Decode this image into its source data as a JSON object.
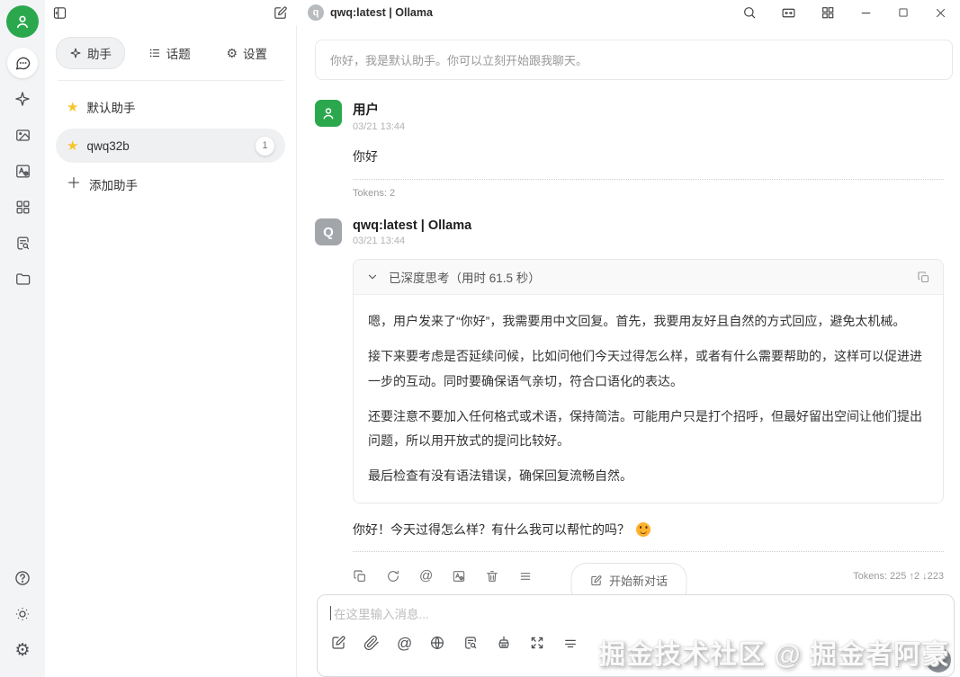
{
  "titlebar": {
    "model": {
      "avatar_letter": "q",
      "label": "qwq:latest | Ollama"
    },
    "icons": [
      "collapse-sidebar",
      "compose",
      "search",
      "expand-window",
      "apps-grid",
      "minimize",
      "maximize",
      "close"
    ]
  },
  "rail": {
    "icons": [
      "user-avatar",
      "chat",
      "assistants-sparkle",
      "images",
      "translate",
      "mini-apps",
      "knowledge-search",
      "files-folder"
    ],
    "bottom_icons": [
      "help",
      "theme-light",
      "settings"
    ]
  },
  "assistants_panel": {
    "tabs": [
      {
        "label": "助手",
        "icon": "sparkle-icon",
        "selected": true
      },
      {
        "label": "话题",
        "icon": "list-icon",
        "selected": false
      },
      {
        "label": "设置",
        "icon": "gear-icon",
        "selected": false
      }
    ],
    "assistants": [
      {
        "label": "默认助手",
        "icon": "star-icon",
        "selected": false
      },
      {
        "label": "qwq32b",
        "icon": "star-icon",
        "badge": "1",
        "selected": true
      }
    ],
    "add_assistant_label": "添加助手"
  },
  "chat": {
    "greeting": "你好，我是默认助手。你可以立刻开始跟我聊天。",
    "messages": [
      {
        "role": "user",
        "name": "用户",
        "time": "03/21 13:44",
        "content": "你好",
        "tokens": "Tokens: 2"
      },
      {
        "role": "assistant",
        "name": "qwq:latest | Ollama",
        "time": "03/21 13:44",
        "avatar_letter": "Q",
        "thinking_header": "已深度思考（用时 61.5 秒）",
        "thinking_paragraphs": [
          "嗯，用户发来了“你好”，我需要用中文回复。首先，我要用友好且自然的方式回应，避免太机械。",
          "接下来要考虑是否延续问候，比如问他们今天过得怎么样，或者有什么需要帮助的，这样可以促进进一步的互动。同时要确保语气亲切，符合口语化的表达。",
          "还要注意不要加入任何格式或术语，保持简洁。可能用户只是打个招呼，但最好留出空间让他们提出问题，所以用开放式的提问比较好。",
          "最后检查有没有语法错误，确保回复流畅自然。"
        ],
        "response": "你好！今天过得怎么样？有什么我可以帮忙的吗？",
        "response_emoji": "😊",
        "tokens": "Tokens: 225 ↑2 ↓223",
        "toolbar_icons": [
          "copy",
          "regenerate",
          "mention",
          "translate",
          "delete",
          "menu"
        ]
      }
    ],
    "new_topic_button": "开始新对话"
  },
  "input": {
    "placeholder": "在这里输入消息...",
    "icons": [
      "new-topic",
      "attach",
      "mention",
      "web-search",
      "knowledge",
      "clear-context",
      "fullscreen",
      "collapse-input"
    ]
  },
  "watermark": "掘金技术社区 @ 掘金者阿豪",
  "colors": {
    "accent_green": "#2ba84d",
    "star_yellow": "#f7c52b",
    "emoji_orange": "#ffb02e"
  }
}
